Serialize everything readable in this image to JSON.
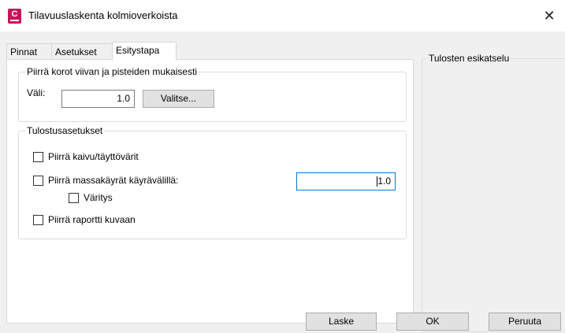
{
  "window": {
    "title": "Tilavuuslaskenta kolmioverkoista",
    "icon_letter": "C",
    "icon_name": "civil-app-icon",
    "close_glyph": "✕"
  },
  "tabs": [
    {
      "label": "Pinnat",
      "active": false
    },
    {
      "label": "Asetukset",
      "active": false
    },
    {
      "label": "Esitystapa",
      "active": true
    }
  ],
  "grid_group": {
    "legend": "Piirrä korot viivan ja pisteiden mukaisesti",
    "interval_label": "Väli:",
    "interval_value": "1.0",
    "select_button": "Valitse..."
  },
  "output_group": {
    "legend": "Tulostusasetukset",
    "options": [
      {
        "label": "Piirrä kaivu/täyttövärit",
        "checked": false
      },
      {
        "label": "Piirrä massakäyrät käyrävälillä:",
        "checked": false
      },
      {
        "label": "Väritys",
        "checked": false
      },
      {
        "label": "Piirrä raportti kuvaan",
        "checked": false
      }
    ],
    "contour_interval_value": "1.0"
  },
  "preview": {
    "legend": "Tulosten esikatselu"
  },
  "buttons": {
    "calculate": "Laske",
    "ok": "OK",
    "cancel": "Peruuta"
  },
  "colors": {
    "accent_focus": "#0078d7",
    "app_icon": "#c2185b"
  }
}
